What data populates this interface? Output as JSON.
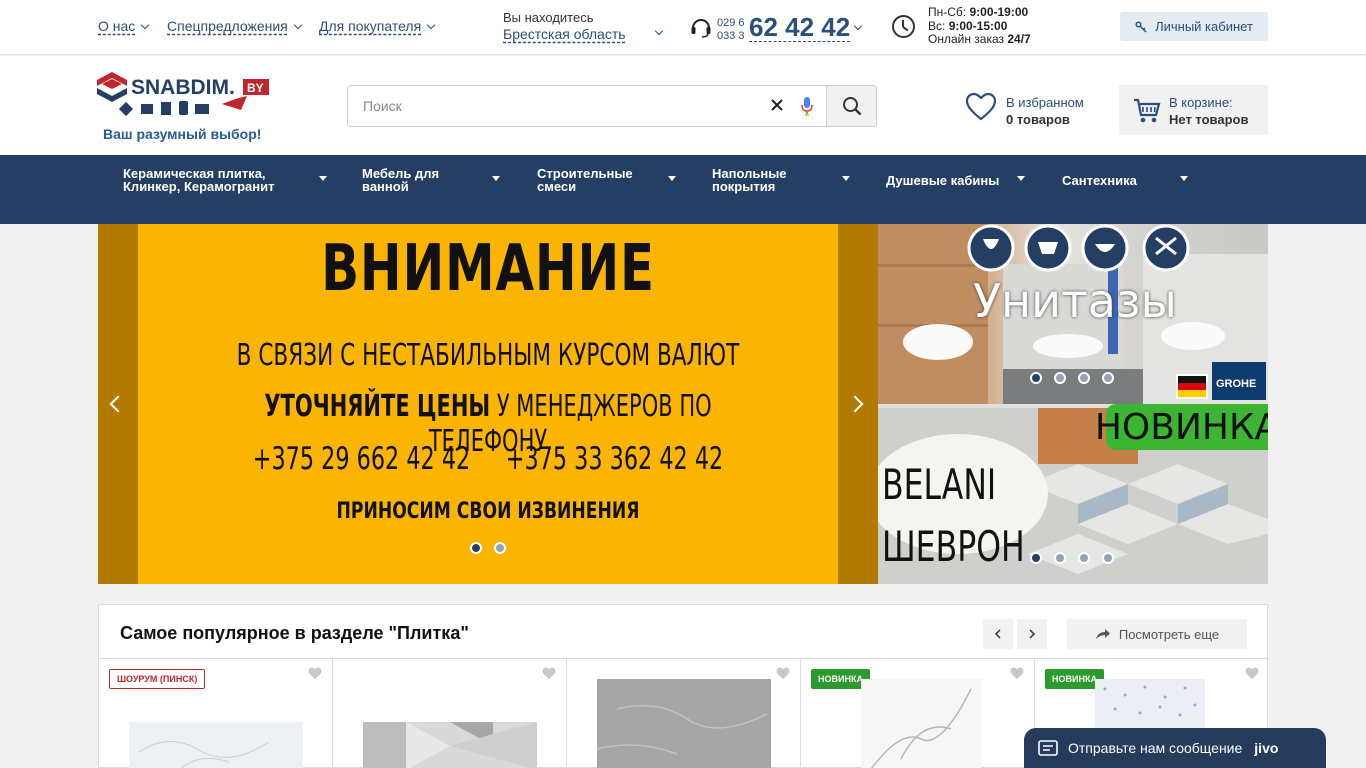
{
  "topbar": {
    "links": [
      "О нас",
      "Спецпредложения",
      "Для покупателя"
    ],
    "location_label": "Вы находитесь",
    "location_value": "Брестская область",
    "phone_codes": [
      "029 6",
      "033 3"
    ],
    "phone_number": "62 42 42",
    "hours": {
      "weekdays_label": "Пн-Сб:",
      "weekdays_value": "9:00-19:00",
      "sunday_label": "Вс:",
      "sunday_value": "9:00-15:00",
      "online_label": "Онлайн заказ",
      "online_value": "24/7"
    },
    "cabinet_label": "Личный кабинет"
  },
  "header": {
    "logo_text": "SNABDIM.",
    "logo_suffix": "BY",
    "slogan": "Ваш разумный выбор!",
    "search_placeholder": "Поиск",
    "favorites_label": "В избранном",
    "favorites_count": "0 товаров",
    "cart_label": "В корзине:",
    "cart_value": "Нет товаров"
  },
  "nav": {
    "items": [
      {
        "line1": "Керамическая плитка,",
        "line2": "Клинкер, Керамогранит"
      },
      {
        "line1": "Мебель для",
        "line2": "ванной"
      },
      {
        "line1": "Строительные",
        "line2": "смеси"
      },
      {
        "line1": "Напольные",
        "line2": "покрытия"
      },
      {
        "line1": "Душевые кабины",
        "line2": ""
      },
      {
        "line1": "Сантехника",
        "line2": ""
      }
    ]
  },
  "banner": {
    "title": "ВНИМАНИЕ",
    "line1": "В СВЯЗИ С НЕСТАБИЛЬНЫМ КУРСОМ ВАЛЮТ",
    "line2_bold": "УТОЧНЯЙТЕ ЦЕНЫ",
    "line2_rest": " У МЕНЕДЖЕРОВ ПО ТЕЛЕФОНУ",
    "phone1": "+375 29 662 42 42",
    "phone2": "+375 33 362 42 42",
    "line4": "ПРИНОСИМ СВОИ ИЗВИНЕНИЯ",
    "slide_count": 2,
    "active_slide": 1
  },
  "side_banners": {
    "top_title": "Унитазы",
    "top_brand": "GROHE",
    "bottom_badge": "НОВИНКА",
    "bottom_line1": "BELANI",
    "bottom_line2": "ШЕВРОН"
  },
  "popular": {
    "title": "Самое популярное в разделе \"Плитка\"",
    "more_label": "Посмотреть еще",
    "cards": [
      {
        "tag": "ШОУРУМ (ПИНСК)",
        "tag_color": "#c0272d"
      },
      {
        "tag": ""
      },
      {
        "tag": ""
      },
      {
        "tag": "НОВИНКА",
        "tag_color": "#2c9a2c"
      },
      {
        "tag": "НОВИНКА",
        "tag_color": "#2c9a2c"
      }
    ]
  },
  "chat": {
    "label": "Отправьте нам сообщение",
    "brand": "jivo"
  },
  "colors": {
    "nav_bg": "#243f63",
    "link": "#2a4f7a",
    "banner_yellow": "#fbb400",
    "new_green": "#2c9a2c"
  }
}
